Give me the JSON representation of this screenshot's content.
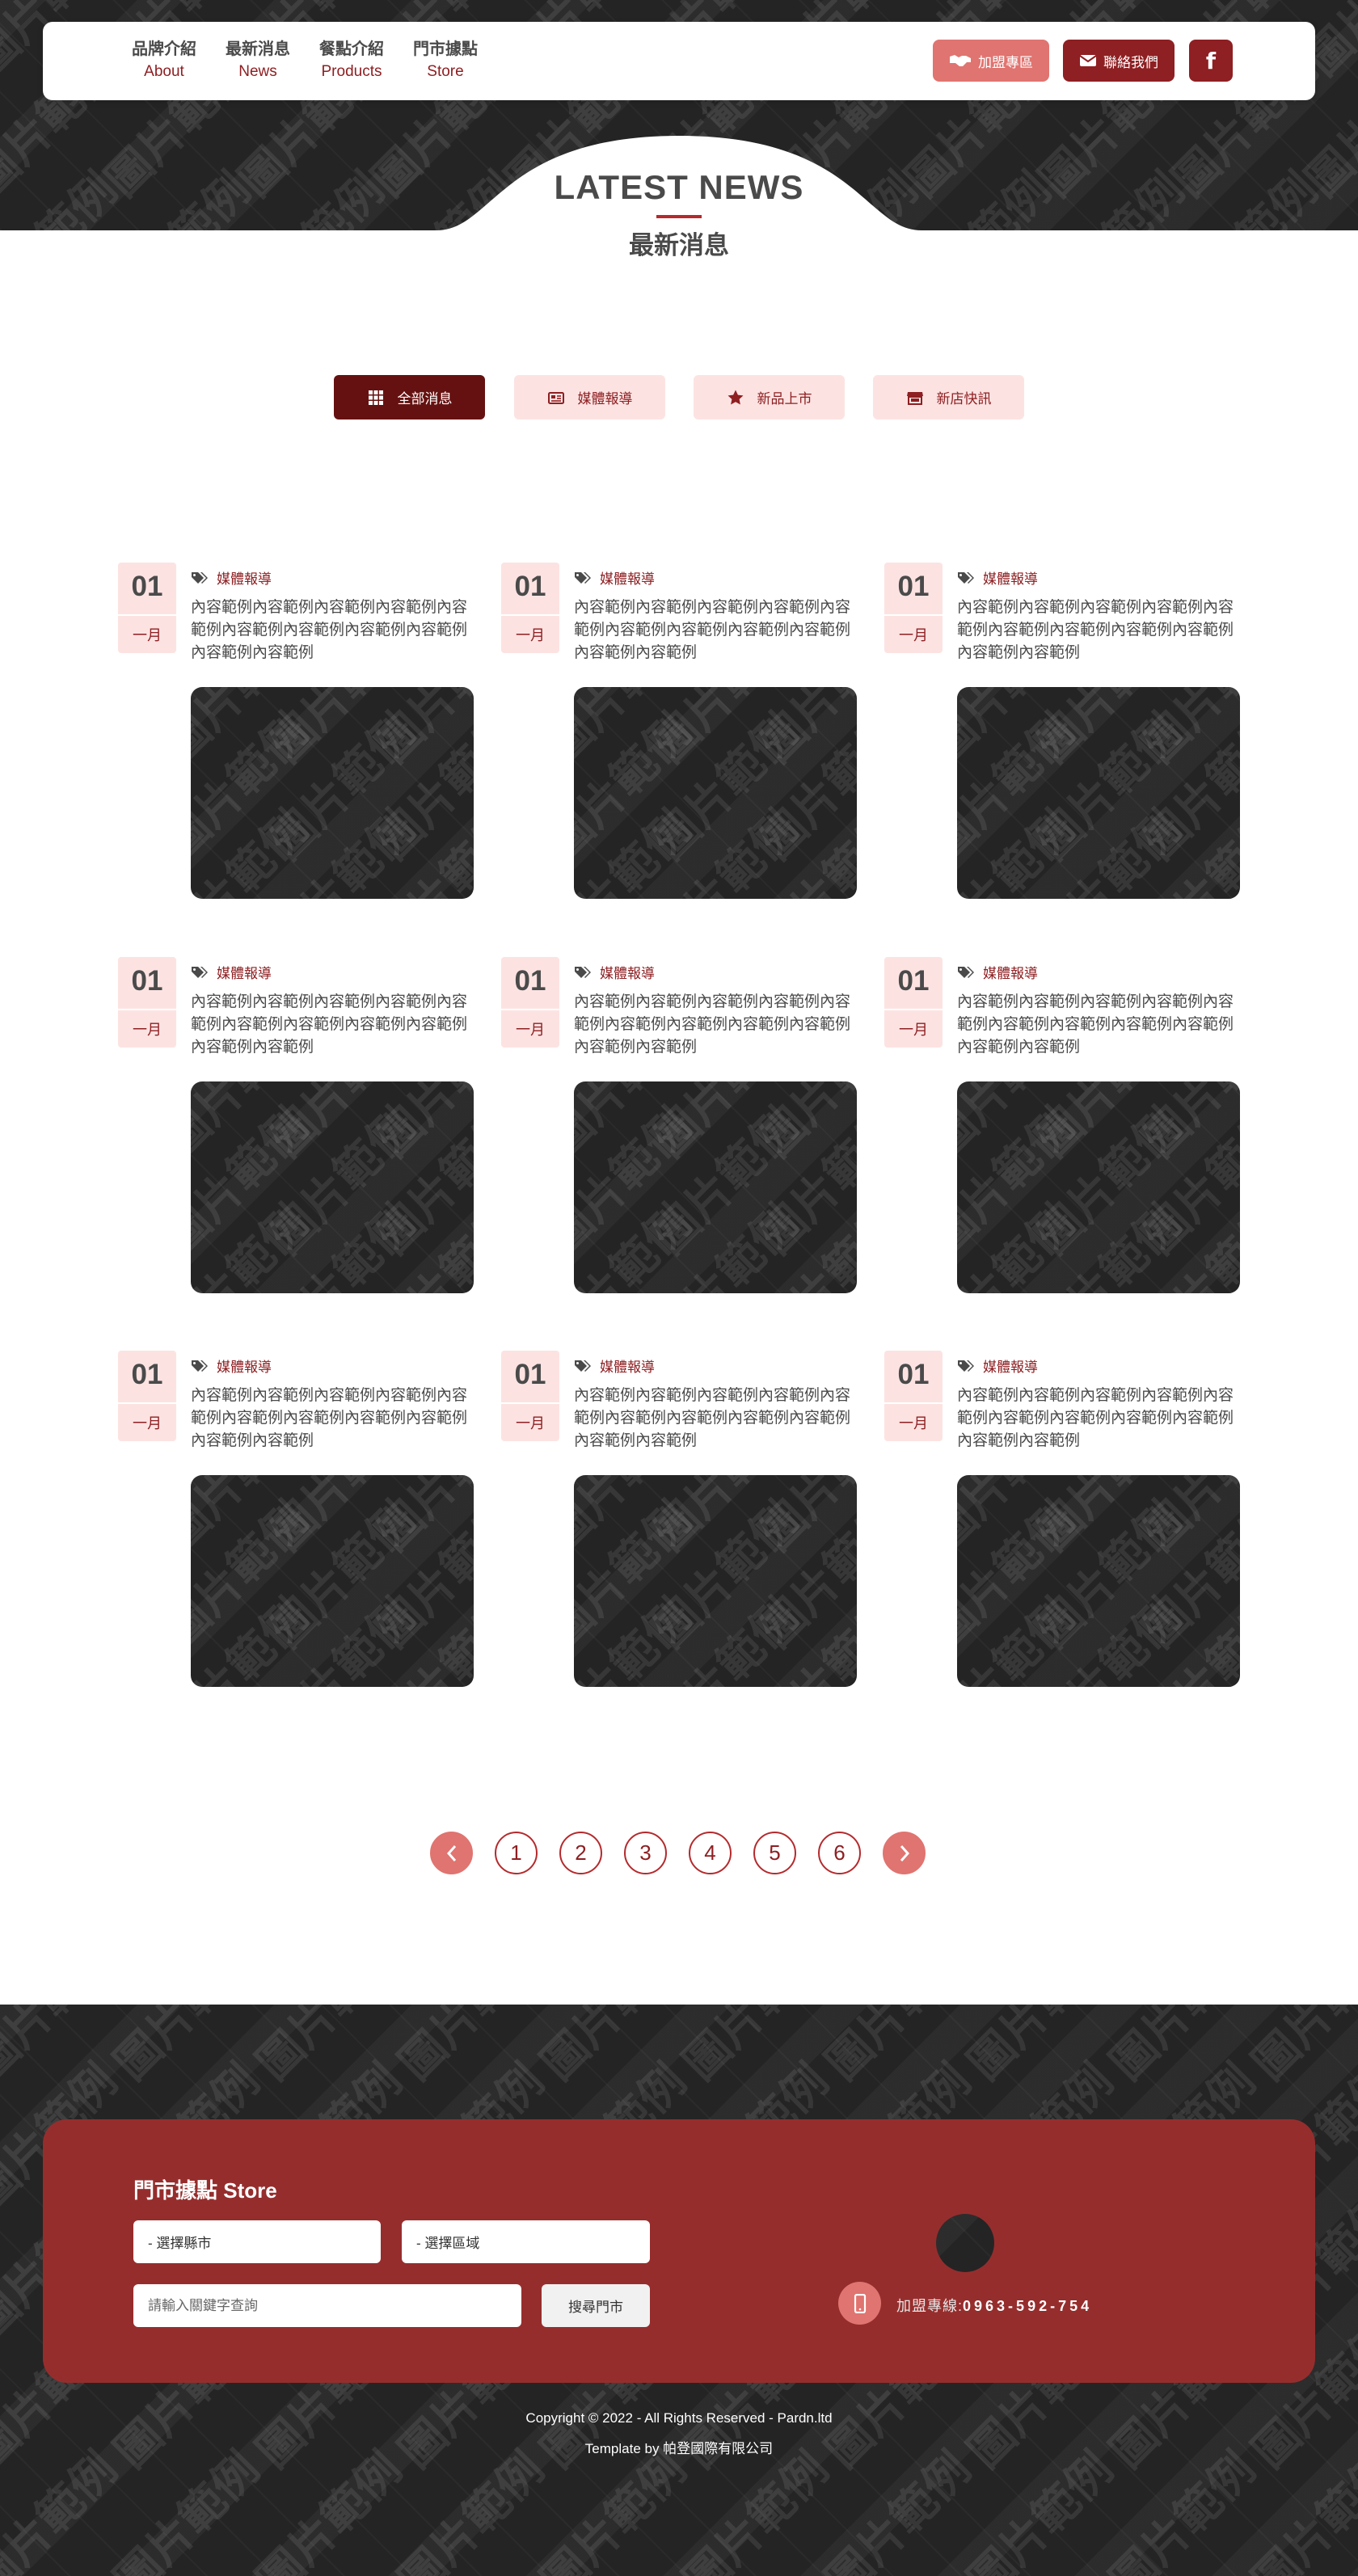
{
  "nav": {
    "items": [
      {
        "zh": "品牌介紹",
        "en": "About"
      },
      {
        "zh": "最新消息",
        "en": "News"
      },
      {
        "zh": "餐點介紹",
        "en": "Products"
      },
      {
        "zh": "門市據點",
        "en": "Store"
      }
    ],
    "join_label": "加盟專區",
    "contact_label": "聯絡我們",
    "facebook_label": "f"
  },
  "page": {
    "title_en": "LATEST NEWS",
    "title_zh": "最新消息"
  },
  "tabs": [
    {
      "label": "全部消息",
      "icon": "grid-icon",
      "active": true
    },
    {
      "label": "媒體報導",
      "icon": "newspaper-icon",
      "active": false
    },
    {
      "label": "新品上市",
      "icon": "star-icon",
      "active": false
    },
    {
      "label": "新店快訊",
      "icon": "store-icon",
      "active": false
    }
  ],
  "news": [
    {
      "day": "01",
      "month": "一月",
      "category": "媒體報導",
      "excerpt": "內容範例內容範例內容範例內容範例內容範例內容範例內容範例內容範例內容範例內容範例內容範例"
    },
    {
      "day": "01",
      "month": "一月",
      "category": "媒體報導",
      "excerpt": "內容範例內容範例內容範例內容範例內容範例內容範例內容範例內容範例內容範例內容範例內容範例"
    },
    {
      "day": "01",
      "month": "一月",
      "category": "媒體報導",
      "excerpt": "內容範例內容範例內容範例內容範例內容範例內容範例內容範例內容範例內容範例內容範例內容範例"
    },
    {
      "day": "01",
      "month": "一月",
      "category": "媒體報導",
      "excerpt": "內容範例內容範例內容範例內容範例內容範例內容範例內容範例內容範例內容範例內容範例內容範例"
    },
    {
      "day": "01",
      "month": "一月",
      "category": "媒體報導",
      "excerpt": "內容範例內容範例內容範例內容範例內容範例內容範例內容範例內容範例內容範例內容範例內容範例"
    },
    {
      "day": "01",
      "month": "一月",
      "category": "媒體報導",
      "excerpt": "內容範例內容範例內容範例內容範例內容範例內容範例內容範例內容範例內容範例內容範例內容範例"
    },
    {
      "day": "01",
      "month": "一月",
      "category": "媒體報導",
      "excerpt": "內容範例內容範例內容範例內容範例內容範例內容範例內容範例內容範例內容範例內容範例內容範例"
    },
    {
      "day": "01",
      "month": "一月",
      "category": "媒體報導",
      "excerpt": "內容範例內容範例內容範例內容範例內容範例內容範例內容範例內容範例內容範例內容範例內容範例"
    },
    {
      "day": "01",
      "month": "一月",
      "category": "媒體報導",
      "excerpt": "內容範例內容範例內容範例內容範例內容範例內容範例內容範例內容範例內容範例內容範例內容範例"
    }
  ],
  "watermark_text": "圖片範例",
  "pagination": {
    "prev_icon": "chevron-left-icon",
    "pages": [
      "1",
      "2",
      "3",
      "4",
      "5",
      "6"
    ],
    "next_icon": "chevron-right-icon"
  },
  "store": {
    "title": "門市據點 Store",
    "city_select": "- 選擇縣市",
    "district_select": "- 選擇區域",
    "search_placeholder": "請輸入關鍵字查詢",
    "search_button": "搜尋門市",
    "hotline_label": "加盟專線:",
    "hotline_number": "0963-592-754"
  },
  "footer": {
    "copyright": "Copyright © 2022 - All Rights Reserved - Pardn.ltd",
    "template_by": "Template by 帕登國際有限公司"
  },
  "colors": {
    "brand_dark": "#8e1f22",
    "brand_deep": "#661111",
    "accent_pink": "#e07470",
    "tab_bg": "#fce3e2",
    "panel": "#962d2d",
    "dark_bg": "#242424"
  }
}
